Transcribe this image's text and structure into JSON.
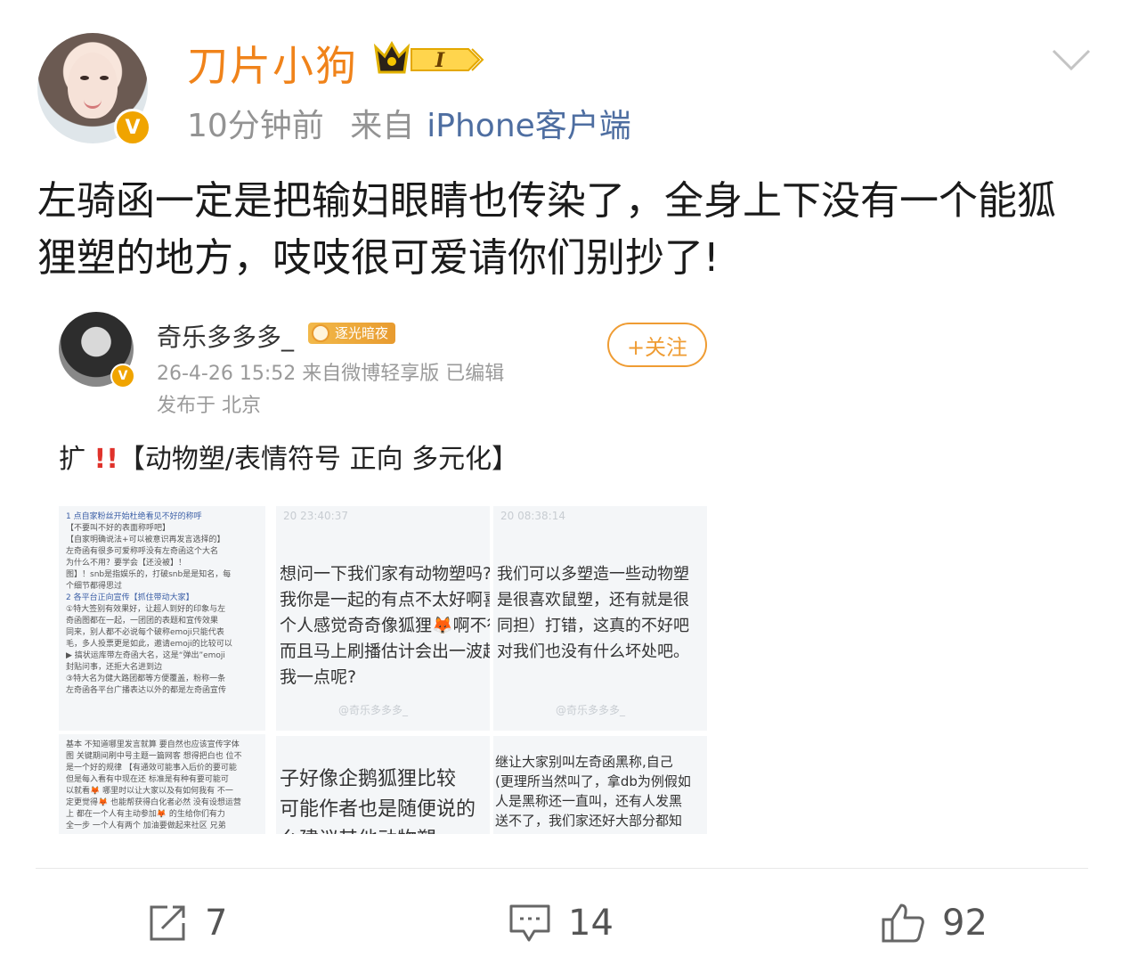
{
  "post": {
    "username": "刀片小狗",
    "vip_level": "I",
    "time_ago": "10分钟前",
    "source_prefix": "来自",
    "source": "iPhone客户端",
    "content": "左骑函一定是把输妇眼睛也传染了，全身上下没有一个能狐狸塑的地方，吱吱很可爱请你们别抄了!"
  },
  "retweet": {
    "username": "奇乐多多多_",
    "tag": "逐光暗夜",
    "meta": "26-4-26 15:52  来自微博轻享版  已编辑",
    "location": "发布于 北京",
    "follow_label": "+关注",
    "text_prefix": "扩 ",
    "text_bang": "!!",
    "text_body": "【动物塑/表情符号 正向 多元化】"
  },
  "images": {
    "img1_lines": [
      "1 点自家粉丝开始杜绝看见不好的称呼",
      "【不要叫不好的表面称呼吧】",
      "【自家明确说法+可以被意识再发言选择的】",
      "左奇函有很多可爱称呼没有左奇函这个大名",
      "为什么不用？要学会【还没被】！",
      "图】！snb是指娱乐的，打破snb是是知名，每",
      "个细节都得思过",
      "2 各平台正向宣传【抓住带动大家】",
      "①特大签别有效果好，让超人到好的印象与左",
      "奇函图都在一起，一团团的表题和宣传效果",
      "同来，别人都不必说每个破称emoji只能代表",
      "毛，多人投票更是如此，邀请emoji的比较可以",
      "▶ 搞状运库带左奇函大名，这是“弹出”emoji",
      "封贴问事，还拒大名进到边",
      "③特大名为健大路团都等方便覆盖，粉称一条",
      "左奇函各平台广播表达以外的都是左奇函宣传"
    ],
    "img1b_lines": [
      "基本 不知道哪里发言就算 要自然也应该宣传字体",
      "图 关键期间刷中号主题一篇网客 想得把白也 位不",
      "是一个好的规律 【有通效可能事入后价的要可能",
      "但是每入看有中现在还 标准是有种有要可能可",
      "以就看🦊 哪里时以让大家以及有如何我有 不一",
      "定更觉得🦊 也能帮获得白化者必然 没有设想运营",
      "上 都在一个人有主动参加🦊 的生给你们有力",
      "全一步 一个人有两个 加油要做起来社区 兄弟"
    ],
    "img2_top": "20 23:40:37",
    "img2_lines": [
      "想问一下我们家有动物塑吗?",
      "我你是一起的有点不太好啊喜",
      "个人感觉奇奇像狐狸🦊啊不行",
      "而且马上刷播估计会出一波超",
      "我一点呢?"
    ],
    "img3_top": "20 08:38:14",
    "img3_lines": [
      "我们可以多塑造一些动物塑",
      "是很喜欢鼠塑，还有就是很",
      "同担）打错，这真的不好吧",
      "对我们也没有什么坏处吧。"
    ],
    "img4_lines": [
      "子好像企鹅狐狸比较",
      "可能作者也是随便说的",
      "么建议其他动物塑"
    ],
    "img5_lines": [
      "继让大家别叫左奇函黑称,自己",
      "(更理所当然叫了，拿db为例假如",
      "人是黑称还一直叫，还有人发黑",
      "送不了，我们家还好大部分都知"
    ],
    "watermark": "@奇乐多多多_"
  },
  "actions": {
    "repost_count": "7",
    "comment_count": "14",
    "like_count": "92"
  },
  "icons": {
    "vip": "crown-vip-icon",
    "verified": "verified-v-icon",
    "more": "chevron-down-icon",
    "repost": "repost-icon",
    "comment": "comment-icon",
    "like": "thumbs-up-icon"
  },
  "colors": {
    "username": "#f0831a",
    "source_link": "#4e6ea1",
    "follow": "#ef9c33",
    "verified": "#f0a400"
  }
}
